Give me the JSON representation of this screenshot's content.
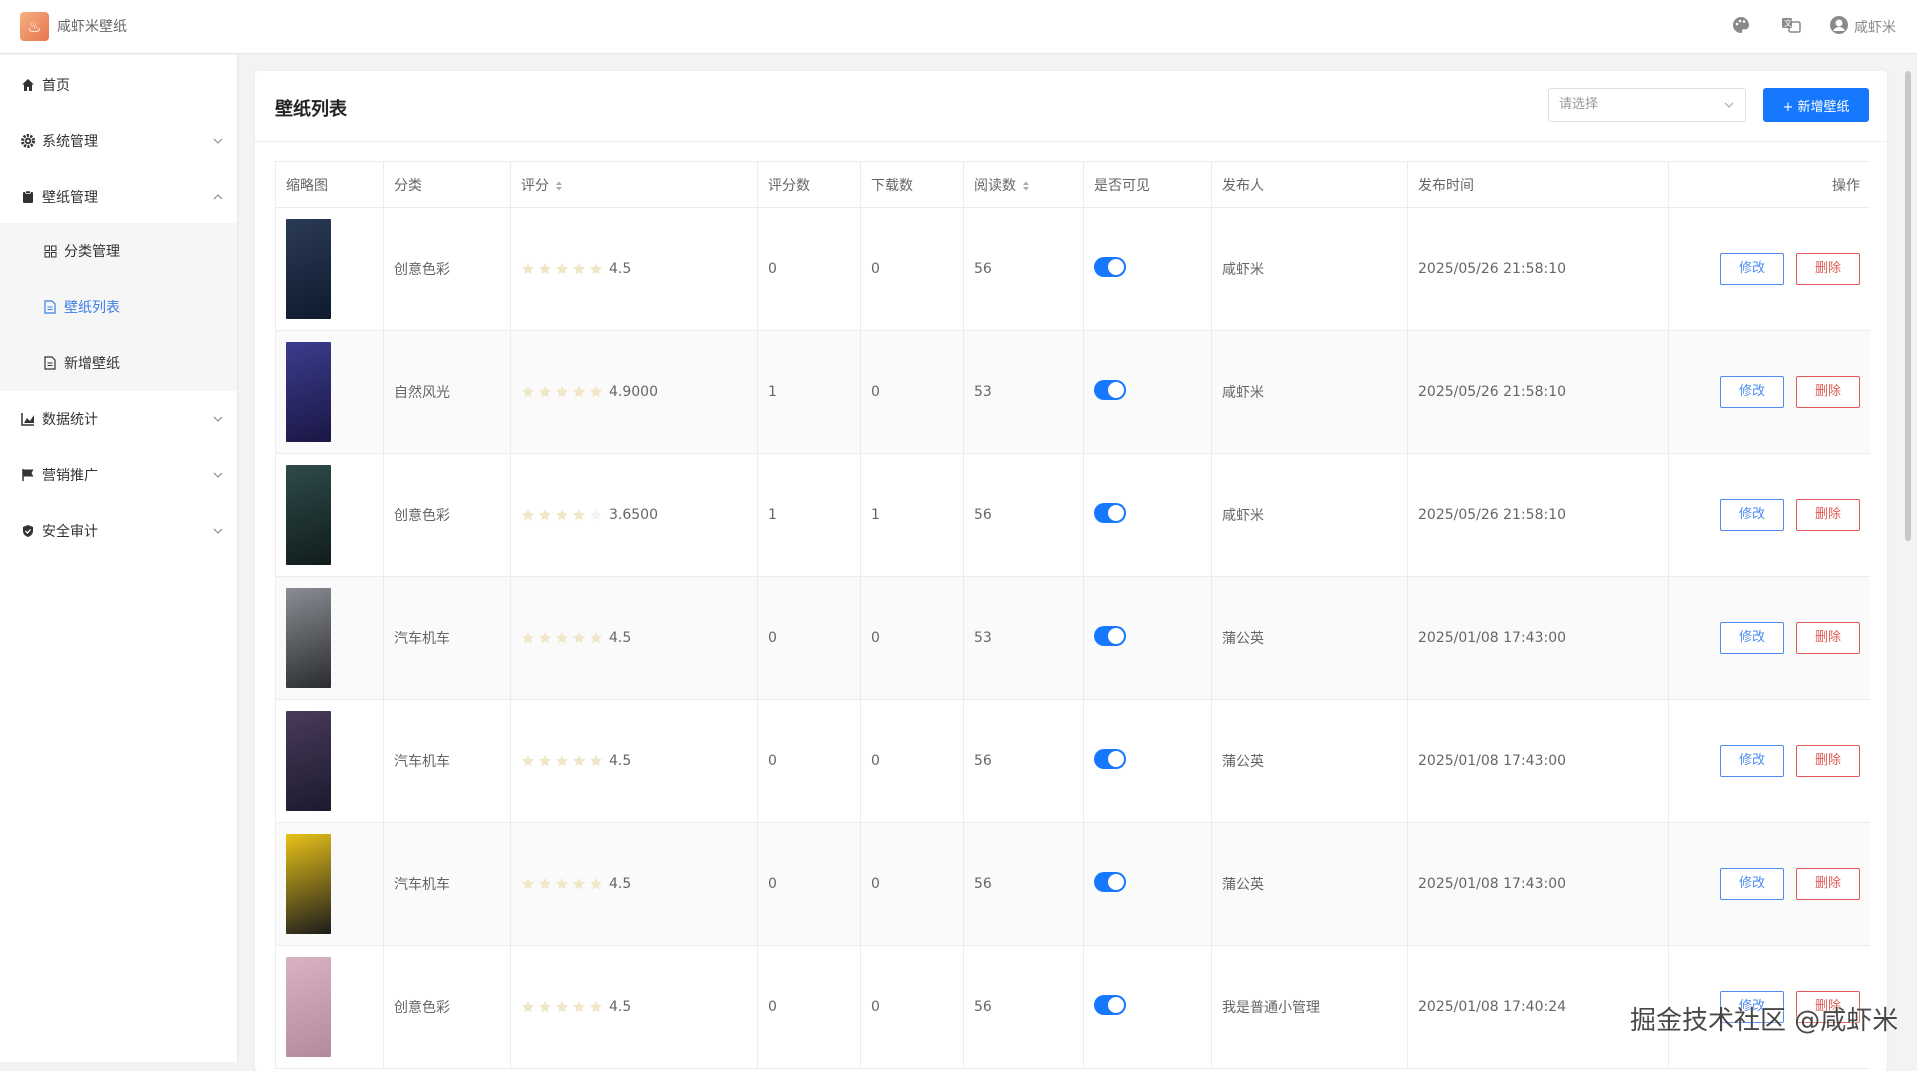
{
  "header": {
    "app_title": "咸虾米壁纸",
    "user_name": "咸虾米"
  },
  "sidebar": {
    "items": [
      {
        "label": "首页",
        "icon": "home-icon"
      },
      {
        "label": "系统管理",
        "icon": "gear-icon"
      },
      {
        "label": "壁纸管理",
        "icon": "clipboard-icon"
      },
      {
        "label": "分类管理",
        "icon": "grid-icon"
      },
      {
        "label": "壁纸列表",
        "icon": "document-icon"
      },
      {
        "label": "新增壁纸",
        "icon": "document-icon"
      },
      {
        "label": "数据统计",
        "icon": "chart-icon"
      },
      {
        "label": "营销推广",
        "icon": "flag-icon"
      },
      {
        "label": "安全审计",
        "icon": "shield-icon"
      }
    ]
  },
  "main": {
    "title": "壁纸列表",
    "select_placeholder": "请选择",
    "add_button": "+ 新增壁纸",
    "columns": [
      "缩略图",
      "分类",
      "评分",
      "评分数",
      "下载数",
      "阅读数",
      "是否可见",
      "发布人",
      "发布时间",
      "操作"
    ],
    "rows": [
      {
        "category": "创意色彩",
        "stars": 5,
        "rating": "4.5",
        "rating_count": "0",
        "downloads": "0",
        "reads": "56",
        "visible": true,
        "publisher": "咸虾米",
        "time": "2025/05/26 21:58:10",
        "thumb_colors": [
          "#2b3a55",
          "#0e1a2e"
        ]
      },
      {
        "category": "自然风光",
        "stars": 5,
        "rating": "4.9000",
        "rating_count": "1",
        "downloads": "0",
        "reads": "53",
        "visible": true,
        "publisher": "咸虾米",
        "time": "2025/05/26 21:58:10",
        "thumb_colors": [
          "#3b3c8e",
          "#1a1744"
        ]
      },
      {
        "category": "创意色彩",
        "stars": 4,
        "rating": "3.6500",
        "rating_count": "1",
        "downloads": "1",
        "reads": "56",
        "visible": true,
        "publisher": "咸虾米",
        "time": "2025/05/26 21:58:10",
        "thumb_colors": [
          "#2f4a4a",
          "#101c1c"
        ]
      },
      {
        "category": "汽车机车",
        "stars": 5,
        "rating": "4.5",
        "rating_count": "0",
        "downloads": "0",
        "reads": "53",
        "visible": true,
        "publisher": "蒲公英",
        "time": "2025/01/08 17:43:00",
        "thumb_colors": [
          "#8a8d93",
          "#2a2c30"
        ]
      },
      {
        "category": "汽车机车",
        "stars": 5,
        "rating": "4.5",
        "rating_count": "0",
        "downloads": "0",
        "reads": "56",
        "visible": true,
        "publisher": "蒲公英",
        "time": "2025/01/08 17:43:00",
        "thumb_colors": [
          "#4a3a5a",
          "#1b1a2e"
        ]
      },
      {
        "category": "汽车机车",
        "stars": 5,
        "rating": "4.5",
        "rating_count": "0",
        "downloads": "0",
        "reads": "56",
        "visible": true,
        "publisher": "蒲公英",
        "time": "2025/01/08 17:43:00",
        "thumb_colors": [
          "#e8c21a",
          "#1b1b1b"
        ]
      },
      {
        "category": "创意色彩",
        "stars": 5,
        "rating": "4.5",
        "rating_count": "0",
        "downloads": "0",
        "reads": "56",
        "visible": true,
        "publisher": "我是普通小管理",
        "time": "2025/01/08 17:40:24",
        "thumb_colors": [
          "#d9b2c2",
          "#b4899c"
        ]
      }
    ],
    "edit_label": "修改",
    "delete_label": "删除"
  },
  "colors": {
    "accent": "#1677ff",
    "danger": "#e05a55",
    "star": "#f0e6c8"
  },
  "watermark": "掘金技术社区 @咸虾米"
}
